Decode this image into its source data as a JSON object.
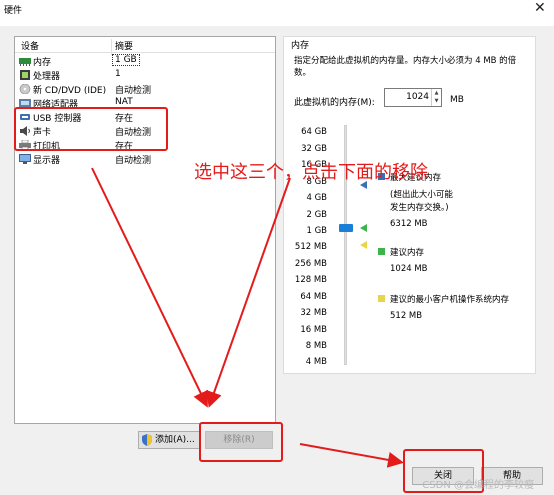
{
  "window": {
    "title": "硬件",
    "close_glyph": "✕"
  },
  "device_list": {
    "col_device": "设备",
    "col_summary": "摘要",
    "rows": [
      {
        "name": "内存",
        "summary": "1 GB",
        "icon": "memory-icon",
        "selected": true
      },
      {
        "name": "处理器",
        "summary": "1",
        "icon": "processor-icon"
      },
      {
        "name": "新 CD/DVD (IDE)",
        "summary": "自动检测",
        "icon": "cd-dvd-icon"
      },
      {
        "name": "网络适配器",
        "summary": "NAT",
        "icon": "network-adapter-icon"
      },
      {
        "name": "USB 控制器",
        "summary": "存在",
        "icon": "usb-icon"
      },
      {
        "name": "声卡",
        "summary": "自动检测",
        "icon": "sound-card-icon"
      },
      {
        "name": "打印机",
        "summary": "存在",
        "icon": "printer-icon"
      },
      {
        "name": "显示器",
        "summary": "自动检测",
        "icon": "display-icon"
      }
    ]
  },
  "buttons": {
    "add": "添加(A)...",
    "remove": "移除(R)",
    "close": "关闭",
    "help": "帮助"
  },
  "memory": {
    "group_title": "内存",
    "description": "指定分配给此虚拟机的内存量。内存大小必须为 4 MB 的倍数。",
    "field_label": "此虚拟机的内存(M):",
    "value": "1024",
    "unit": "MB",
    "scale": [
      "64 GB",
      "32 GB",
      "16 GB",
      "8 GB",
      "4 GB",
      "2 GB",
      "1 GB",
      "512 MB",
      "256 MB",
      "128 MB",
      "64 MB",
      "32 MB",
      "16 MB",
      "8 MB",
      "4 MB"
    ],
    "max_title": "最大建议内存",
    "max_note_1": "(超出此大小可能",
    "max_note_2": "发生内存交换。)",
    "max_value": "6312 MB",
    "rec_title": "建议内存",
    "rec_value": "1024 MB",
    "min_title": "建议的最小客户机操作系统内存",
    "min_value": "512 MB",
    "colors": {
      "max": "#3b6fb5",
      "rec": "#3cb44b",
      "min": "#e8d64a",
      "thumb": "#1a7fd6"
    }
  },
  "annotation": {
    "text": "选中这三个，点击下面的移除",
    "color": "#e31b1b"
  },
  "watermark": "CSDN @会编程的李较瘦"
}
